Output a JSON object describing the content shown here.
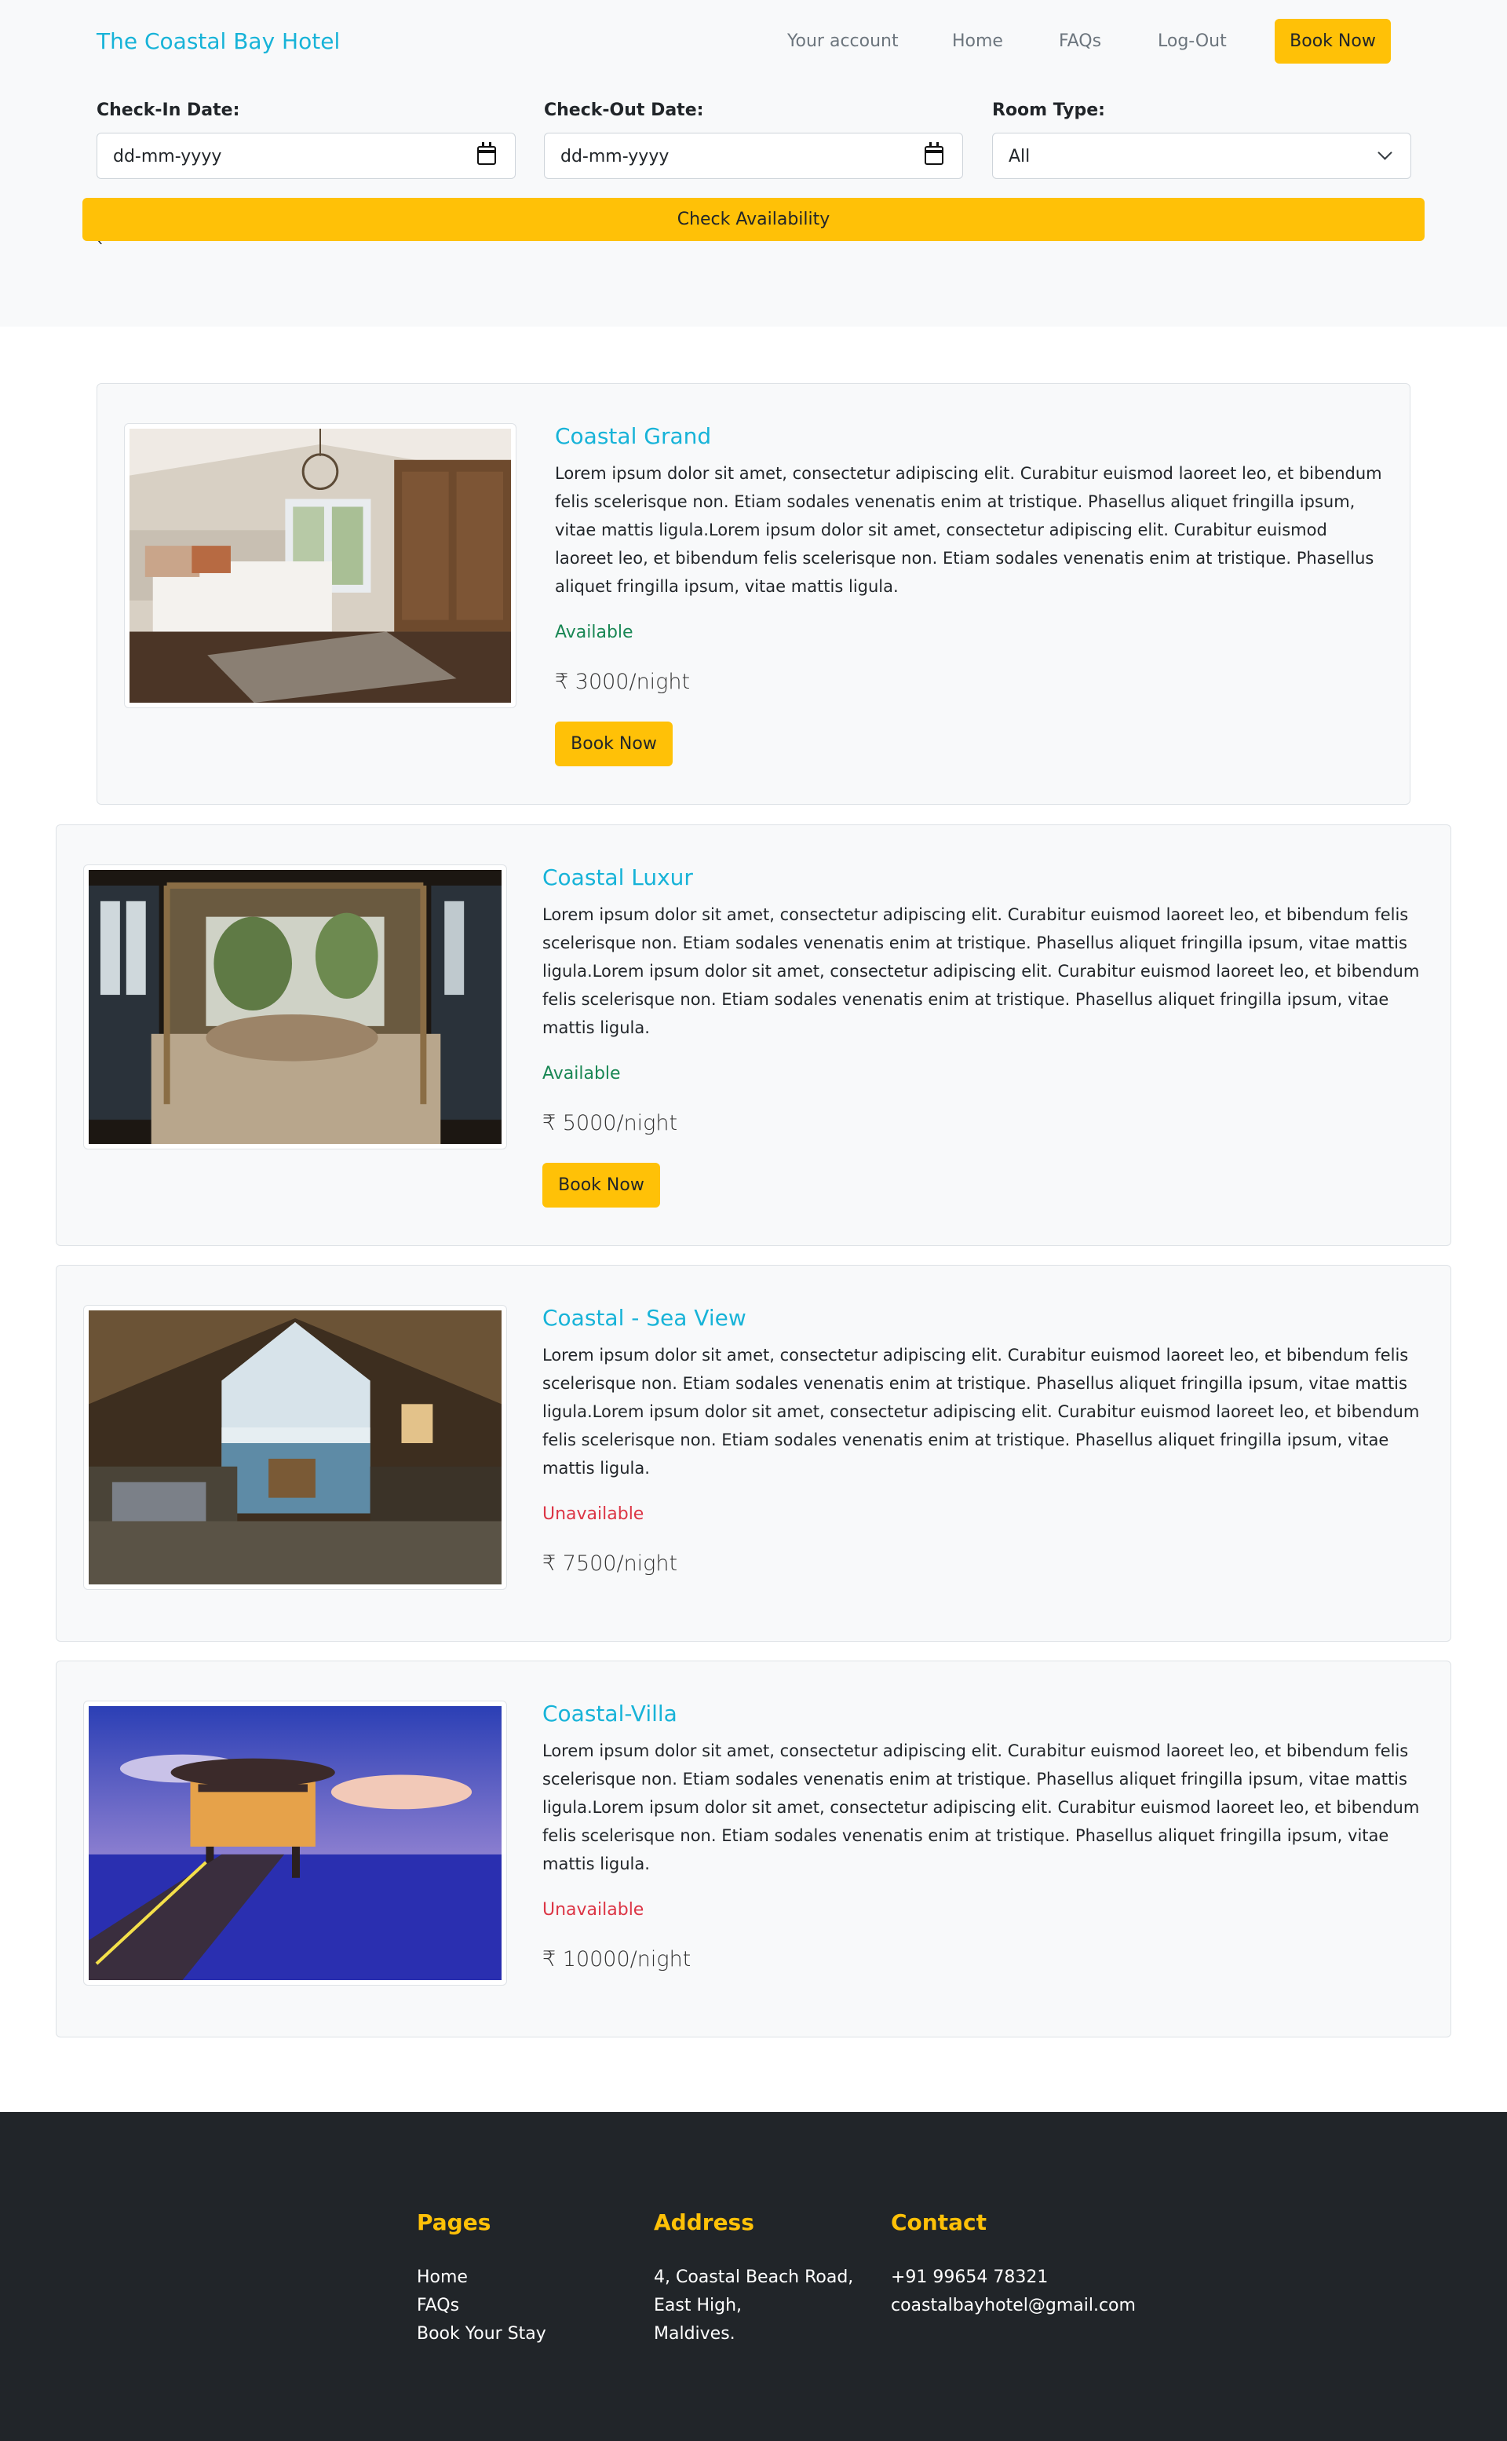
{
  "nav": {
    "brand": "The Coastal Bay Hotel",
    "links": [
      "Your account",
      "Home",
      "FAQs",
      "Log-Out"
    ],
    "book_now": "Book Now"
  },
  "search": {
    "checkin_label": "Check-In Date:",
    "checkout_label": "Check-Out Date:",
    "room_type_label": "Room Type:",
    "date_placeholder": "dd-mm-yyyy",
    "room_type_value": "All",
    "check_button": "Check Availability",
    "stray_char": "`"
  },
  "rooms": [
    {
      "name": "Coastal Grand",
      "description": "Lorem ipsum dolor sit amet, consectetur adipiscing elit. Curabitur euismod laoreet leo, et bibendum felis scelerisque non. Etiam sodales venenatis enim at tristique. Phasellus aliquet fringilla ipsum, vitae mattis ligula.Lorem ipsum dolor sit amet, consectetur adipiscing elit. Curabitur euismod laoreet leo, et bibendum felis scelerisque non. Etiam sodales venenatis enim at tristique. Phasellus aliquet fringilla ipsum, vitae mattis ligula.",
      "status": "Available",
      "price": "₹ 3000/night",
      "button": "Book Now"
    },
    {
      "name": "Coastal Luxur",
      "description": "Lorem ipsum dolor sit amet, consectetur adipiscing elit. Curabitur euismod laoreet leo, et bibendum felis scelerisque non. Etiam sodales venenatis enim at tristique. Phasellus aliquet fringilla ipsum, vitae mattis ligula.Lorem ipsum dolor sit amet, consectetur adipiscing elit. Curabitur euismod laoreet leo, et bibendum felis scelerisque non. Etiam sodales venenatis enim at tristique. Phasellus aliquet fringilla ipsum, vitae mattis ligula.",
      "status": "Available",
      "price": "₹ 5000/night",
      "button": "Book Now"
    },
    {
      "name": "Coastal - Sea View",
      "description": "Lorem ipsum dolor sit amet, consectetur adipiscing elit. Curabitur euismod laoreet leo, et bibendum felis scelerisque non. Etiam sodales venenatis enim at tristique. Phasellus aliquet fringilla ipsum, vitae mattis ligula.Lorem ipsum dolor sit amet, consectetur adipiscing elit. Curabitur euismod laoreet leo, et bibendum felis scelerisque non. Etiam sodales venenatis enim at tristique. Phasellus aliquet fringilla ipsum, vitae mattis ligula.",
      "status": "Unavailable",
      "price": "₹ 7500/night"
    },
    {
      "name": "Coastal-Villa",
      "description": "Lorem ipsum dolor sit amet, consectetur adipiscing elit. Curabitur euismod laoreet leo, et bibendum felis scelerisque non. Etiam sodales venenatis enim at tristique. Phasellus aliquet fringilla ipsum, vitae mattis ligula.Lorem ipsum dolor sit amet, consectetur adipiscing elit. Curabitur euismod laoreet leo, et bibendum felis scelerisque non. Etiam sodales venenatis enim at tristique. Phasellus aliquet fringilla ipsum, vitae mattis ligula.",
      "status": "Unavailable",
      "price": "₹ 10000/night"
    }
  ],
  "footer": {
    "pages_heading": "Pages",
    "pages": [
      "Home",
      "FAQs",
      "Book Your Stay"
    ],
    "address_heading": "Address",
    "address": [
      "4, Coastal Beach Road,",
      "East High,",
      "Maldives."
    ],
    "contact_heading": "Contact",
    "contact": [
      "+91 99654 78321",
      "coastalbayhotel@gmail.com"
    ]
  },
  "colors": {
    "accent": "#ffc107",
    "brand": "#17b3d8",
    "available": "#198754",
    "unavailable": "#dc3545",
    "footer_bg": "#212529"
  }
}
